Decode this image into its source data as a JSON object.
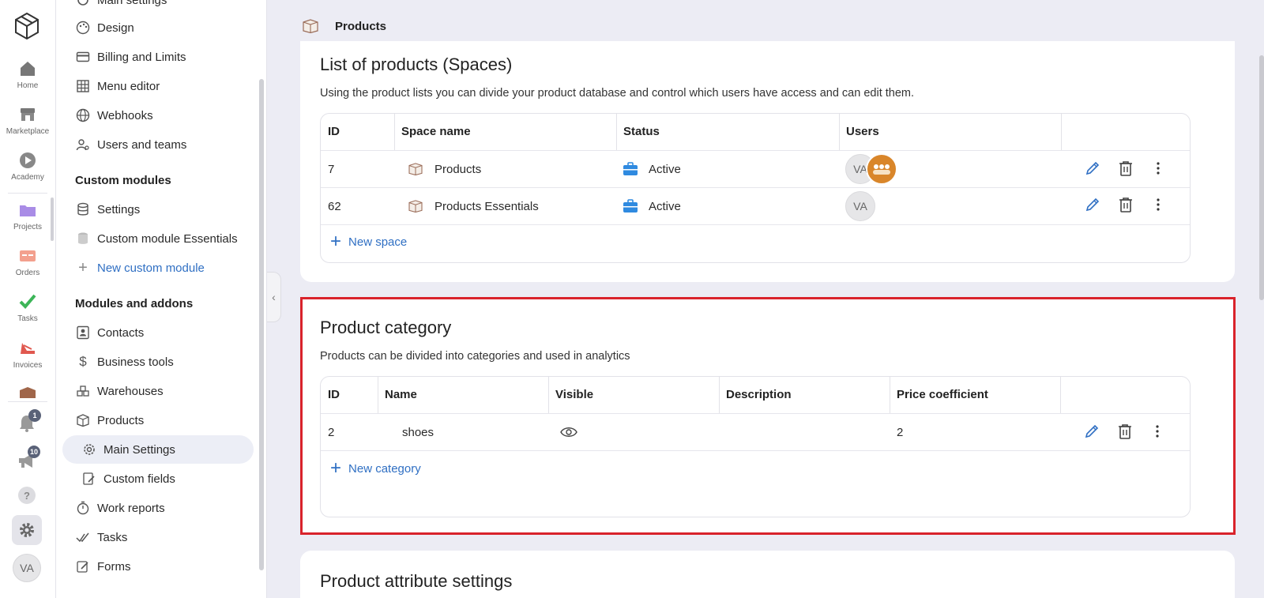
{
  "rail": {
    "items": [
      {
        "label": "Home",
        "icon": "home-icon"
      },
      {
        "label": "Marketplace",
        "icon": "store-icon"
      },
      {
        "label": "Academy",
        "icon": "play-icon"
      },
      {
        "label": "Projects",
        "icon": "folder-icon"
      },
      {
        "label": "Orders",
        "icon": "orders-icon"
      },
      {
        "label": "Tasks",
        "icon": "check-icon"
      },
      {
        "label": "Invoices",
        "icon": "invoice-icon"
      }
    ],
    "notifications_count": "1",
    "announcements_count": "10",
    "user_initials": "VA"
  },
  "sidebar": {
    "partial_top": "Main settings",
    "items_top": [
      {
        "label": "Design",
        "icon": "palette-icon"
      },
      {
        "label": "Billing and Limits",
        "icon": "card-icon"
      },
      {
        "label": "Menu editor",
        "icon": "grid-icon"
      },
      {
        "label": "Webhooks",
        "icon": "globe-icon"
      },
      {
        "label": "Users and teams",
        "icon": "users-gear-icon"
      }
    ],
    "custom_modules_heading": "Custom modules",
    "custom_modules": [
      {
        "label": "Settings",
        "icon": "database-icon"
      },
      {
        "label": "Custom module Essentials",
        "icon": "database-icon"
      }
    ],
    "new_custom_module": "New custom module",
    "modules_heading": "Modules and addons",
    "modules": [
      {
        "label": "Contacts",
        "icon": "contact-icon"
      },
      {
        "label": "Business tools",
        "icon": "dollar-icon"
      },
      {
        "label": "Warehouses",
        "icon": "warehouse-icon"
      },
      {
        "label": "Products",
        "icon": "box-icon"
      }
    ],
    "products_sub": [
      {
        "label": "Main Settings",
        "icon": "gear-icon"
      },
      {
        "label": "Custom fields",
        "icon": "edit-doc-icon"
      }
    ],
    "modules_after": [
      {
        "label": "Work reports",
        "icon": "timer-icon"
      },
      {
        "label": "Tasks",
        "icon": "double-check-icon"
      },
      {
        "label": "Forms",
        "icon": "form-edit-icon"
      }
    ]
  },
  "header": {
    "title": "Products"
  },
  "spaces": {
    "title": "List of products (Spaces)",
    "description": "Using the product lists you can divide your product database and control which users have access and can edit them.",
    "columns": [
      "ID",
      "Space name",
      "Status",
      "Users"
    ],
    "rows": [
      {
        "id": "7",
        "name": "Products",
        "status": "Active",
        "users": "VA"
      },
      {
        "id": "62",
        "name": "Products Essentials",
        "status": "Active",
        "users": "VA"
      }
    ],
    "new_label": "New space"
  },
  "categories": {
    "title": "Product category",
    "description": "Products can be divided into categories and used in analytics",
    "columns": [
      "ID",
      "Name",
      "Visible",
      "Description",
      "Price coefficient"
    ],
    "rows": [
      {
        "id": "2",
        "name": "shoes",
        "description": "",
        "price_coefficient": "2"
      }
    ],
    "new_label": "New category"
  },
  "attributes": {
    "title": "Product attribute settings"
  },
  "colors": {
    "accent": "#2f6fc3",
    "highlight": "#d9232b",
    "status_icon": "#2f8ae0"
  }
}
